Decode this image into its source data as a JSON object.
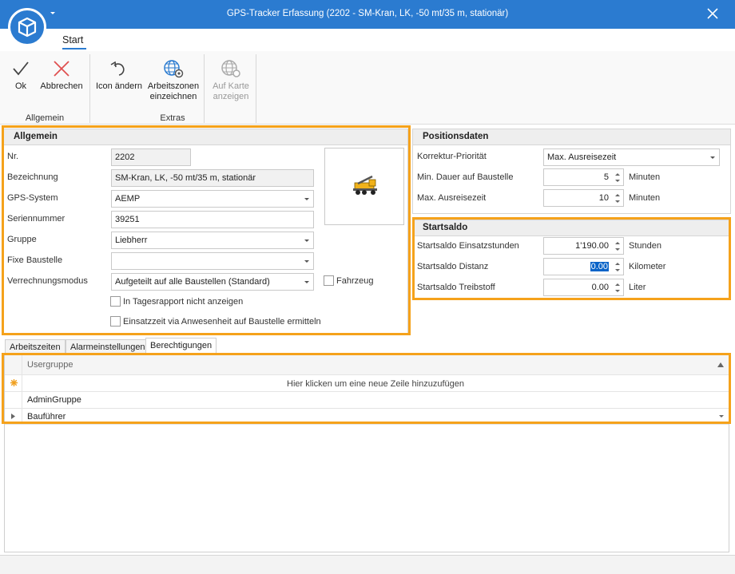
{
  "window": {
    "title": "GPS-Tracker Erfassung (2202 - SM-Kran, LK, -50 mt/35 m, stationär)"
  },
  "ribbon": {
    "tab": "Start",
    "ok": "Ok",
    "cancel": "Abbrechen",
    "change_icon": "Icon ändern",
    "draw_zones_1": "Arbeitszonen",
    "draw_zones_2": "einzeichnen",
    "show_map_1": "Auf Karte",
    "show_map_2": "anzeigen",
    "group_general": "Allgemein",
    "group_extras": "Extras"
  },
  "general": {
    "header": "Allgemein",
    "nr_label": "Nr.",
    "nr_value": "2202",
    "name_label": "Bezeichnung",
    "name_value": "SM-Kran, LK, -50 mt/35 m, stationär",
    "gps_label": "GPS-System",
    "gps_value": "AEMP",
    "serial_label": "Seriennummer",
    "serial_value": "39251",
    "group_label": "Gruppe",
    "group_value": "Liebherr",
    "fixed_site_label": "Fixe Baustelle",
    "fixed_site_value": "",
    "billing_label": "Verrechnungsmodus",
    "billing_value": "Aufgeteilt auf alle Baustellen (Standard)",
    "vehicle_label": "Fahrzeug",
    "hide_report_label": "In Tagesrapport nicht anzeigen",
    "attendance_label": "Einsatzzeit via Anwesenheit auf Baustelle ermitteln"
  },
  "position": {
    "header": "Positionsdaten",
    "priority_label": "Korrektur-Priorität",
    "priority_value": "Max. Ausreisezeit",
    "min_duration_label": "Min. Dauer auf Baustelle",
    "min_duration_value": "5",
    "min_duration_unit": "Minuten",
    "max_exit_label": "Max. Ausreisezeit",
    "max_exit_value": "10",
    "max_exit_unit": "Minuten"
  },
  "startsaldo": {
    "header": "Startsaldo",
    "hours_label": "Startsaldo Einsatzstunden",
    "hours_value": "1'190.00",
    "hours_unit": "Stunden",
    "distance_label": "Startsaldo Distanz",
    "distance_value": "0.00",
    "distance_unit": "Kilometer",
    "fuel_label": "Startsaldo Treibstoff",
    "fuel_value": "0.00",
    "fuel_unit": "Liter"
  },
  "tabs": [
    "Arbeitszeiten",
    "Alarmeinstellungen",
    "Berechtigungen"
  ],
  "grid": {
    "column": "Usergruppe",
    "new_row_hint": "Hier klicken um eine neue Zeile hinzuzufügen",
    "rows": [
      "AdminGruppe",
      "Bauführer"
    ]
  },
  "colors": {
    "title_bar": "#2b7bd0",
    "highlight": "#f5a21b",
    "selection": "#0a64c8"
  }
}
